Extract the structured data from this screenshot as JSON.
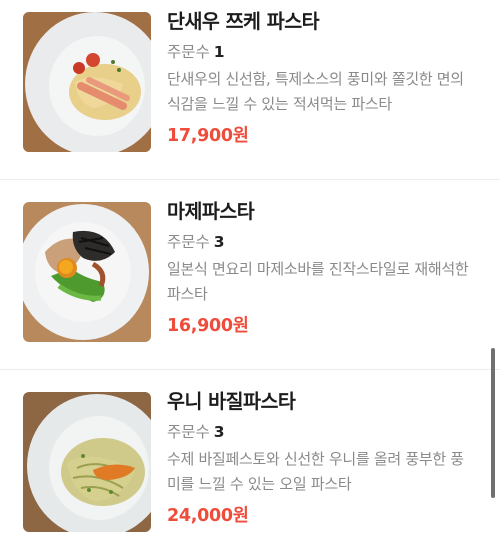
{
  "menu": {
    "items": [
      {
        "name": "단새우 쯔케 파스타",
        "orders_label": "주문수",
        "orders_count": "1",
        "description": "단새우의 신선함, 특제소스의 풍미와 쫄깃한 면의 식감을 느낄 수 있는 적셔먹는 파스타",
        "price": "17,900원",
        "image_icon": "pasta-shrimp-dish-image"
      },
      {
        "name": "마제파스타",
        "orders_label": "주문수",
        "orders_count": "3",
        "description": "일본식 면요리 마제소바를 진작스타일로 재해석한 파스타",
        "price": "16,900원",
        "image_icon": "maze-pasta-dish-image"
      },
      {
        "name": "우니 바질파스타",
        "orders_label": "주문수",
        "orders_count": "3",
        "description": "수제 바질페스토와 신선한 우니를 올려 풍부한 풍미를 느낄 수 있는 오일 파스타",
        "price": "24,000원",
        "image_icon": "uni-basil-pasta-dish-image"
      }
    ]
  },
  "colors": {
    "price": "#ef4d3c",
    "title": "#1c1c1c",
    "secondary_text": "#8a8a8a",
    "divider": "#ececec"
  }
}
